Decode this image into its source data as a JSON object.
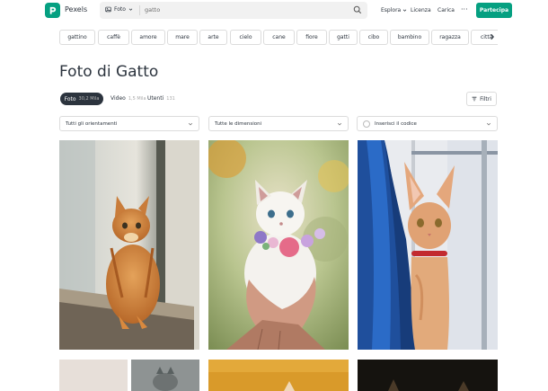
{
  "header": {
    "brand": "Pexels",
    "search_type": "Foto",
    "search_value": "gatto",
    "nav": [
      "Esplora",
      "Licenza",
      "Carica"
    ],
    "join_label": "Partecipa"
  },
  "tags": [
    "gattino",
    "caffè",
    "amore",
    "mare",
    "arte",
    "cielo",
    "cane",
    "fiore",
    "gatti",
    "cibo",
    "bambino",
    "ragazza",
    "città"
  ],
  "page": {
    "title": "Foto di Gatto"
  },
  "tabs": [
    {
      "label": "Foto",
      "count": "30,2 Mila",
      "active": true
    },
    {
      "label": "Video",
      "count": "1,5 Mila",
      "active": false
    },
    {
      "label": "Utenti",
      "count": "131",
      "active": false
    }
  ],
  "filter_label": "Filtri",
  "dropdowns": {
    "orientation": "Tutti gli orientamenti",
    "size": "Tutte le dimensioni",
    "color": "Inserisci il codice"
  },
  "colors": {
    "brand": "#05a081",
    "text": "#2c343e"
  }
}
